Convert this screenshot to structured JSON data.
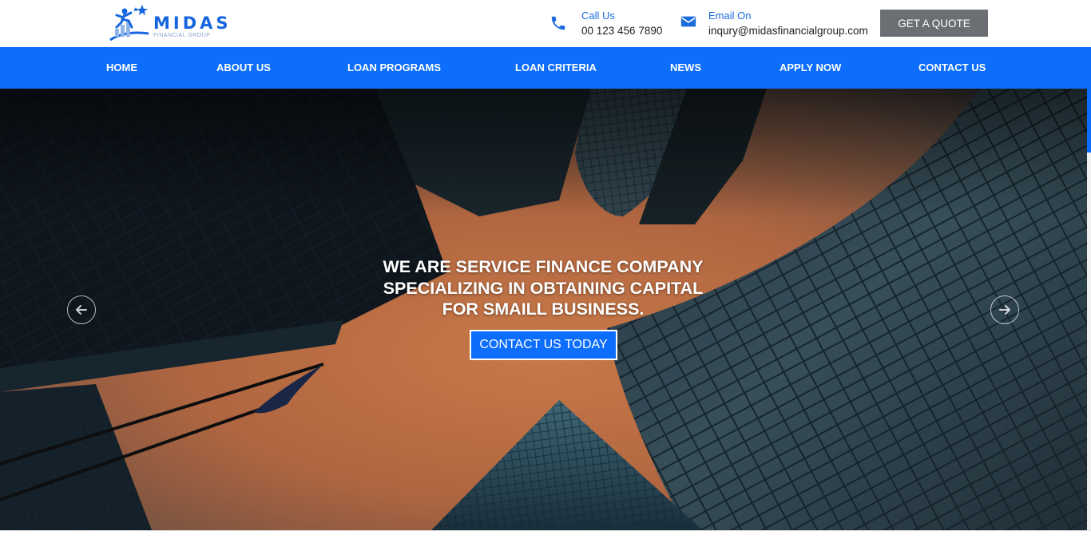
{
  "brand": {
    "name": "MIDAS",
    "tagline": "FINANCIAL GROUP",
    "primary_color": "#0d6efd",
    "logo_icon": "runner-star-logo-icon"
  },
  "header": {
    "phone": {
      "icon": "phone-icon",
      "label": "Call Us",
      "value": "00 123 456 7890"
    },
    "email": {
      "icon": "envelope-icon",
      "label": "Email On",
      "value": "inqury@midasfinancialgroup.com"
    },
    "quote_button": "GET A QUOTE"
  },
  "nav": {
    "items": [
      {
        "label": "HOME"
      },
      {
        "label": "ABOUT US"
      },
      {
        "label": "LOAN PROGRAMS"
      },
      {
        "label": "LOAN CRITERIA"
      },
      {
        "label": "NEWS"
      },
      {
        "label": "APPLY NOW"
      },
      {
        "label": "CONTACT US"
      }
    ]
  },
  "hero": {
    "title_lines": [
      "WE ARE SERVICE FINANCE COMPANY",
      "SPECIALIZING IN OBTAINING CAPITAL",
      "FOR SMAILL BUSINESS."
    ],
    "cta_label": "CONTACT US TODAY",
    "prev_icon": "arrow-left-icon",
    "next_icon": "arrow-right-icon",
    "background": "skyscrapers-sunset-image"
  }
}
